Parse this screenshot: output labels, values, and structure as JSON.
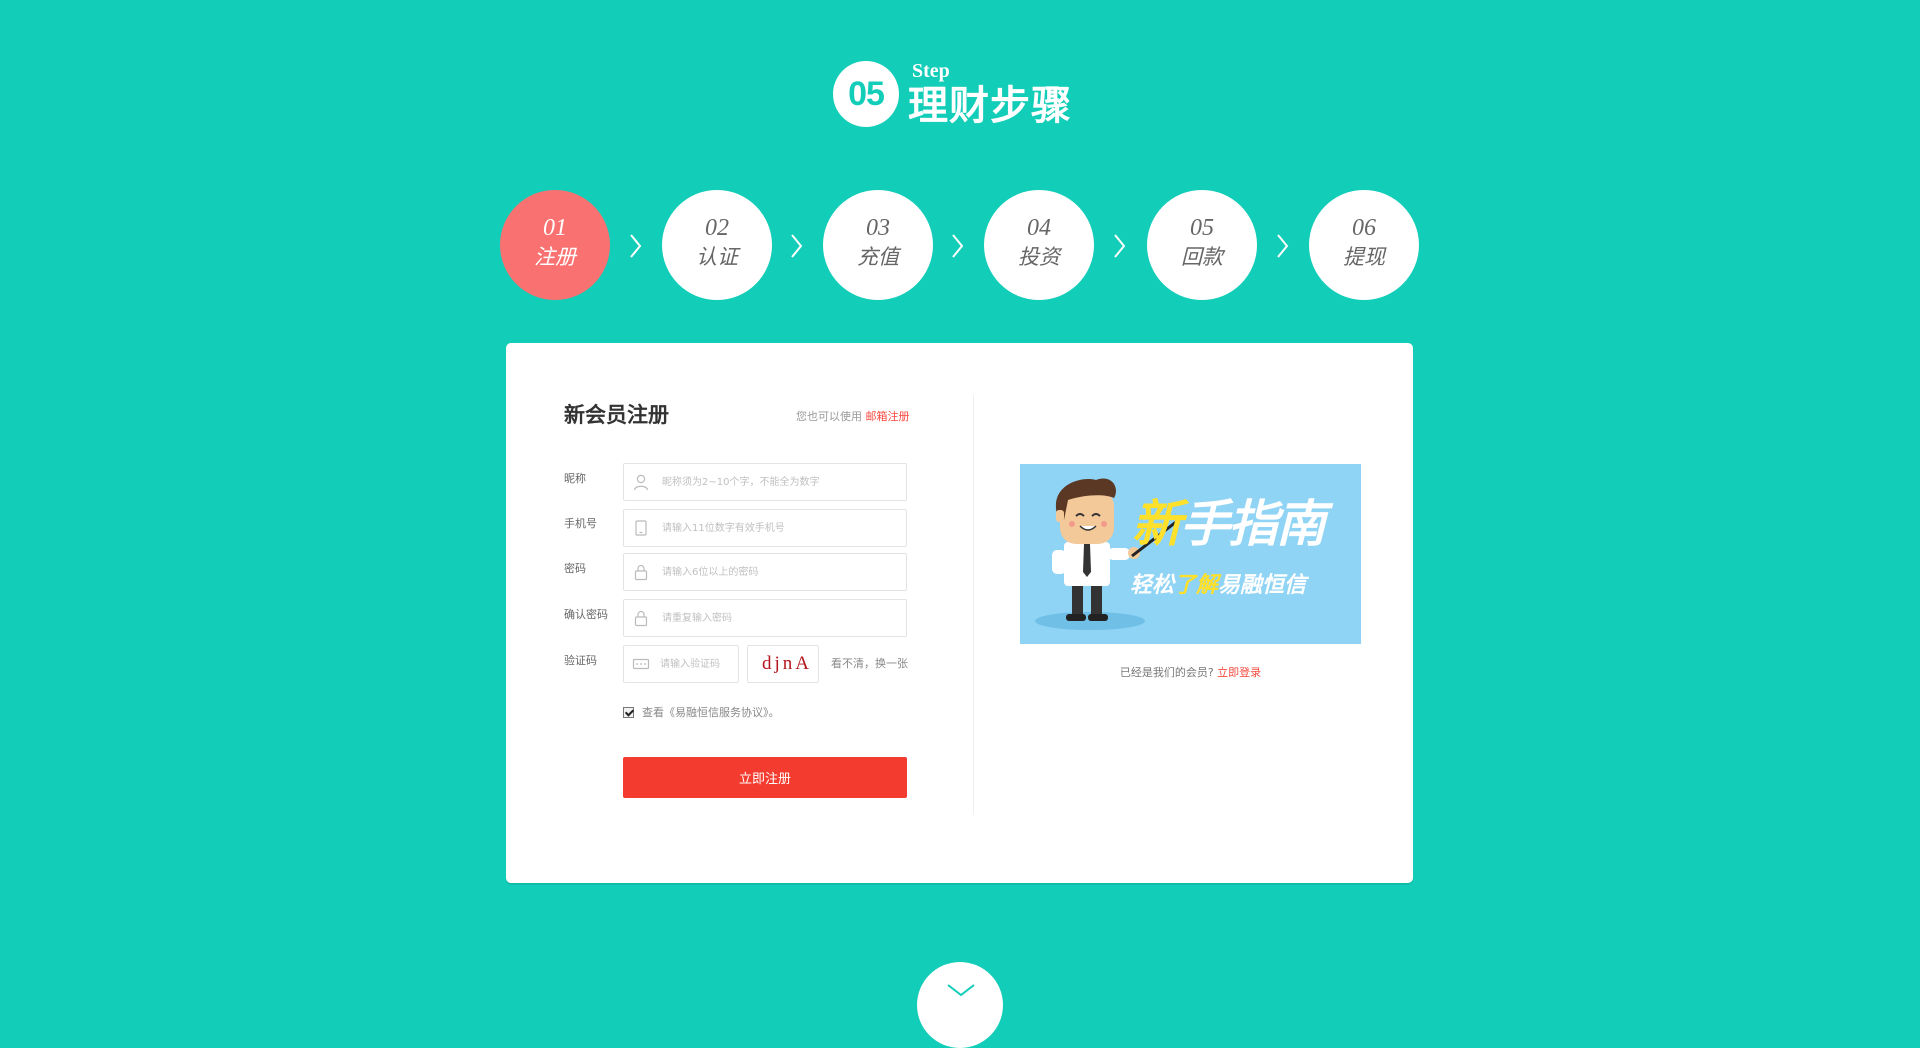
{
  "header": {
    "badge": "05",
    "step_word": "Step",
    "title": "理财步骤"
  },
  "steps": [
    {
      "num": "01",
      "label": "注册",
      "active": true
    },
    {
      "num": "02",
      "label": "认证",
      "active": false
    },
    {
      "num": "03",
      "label": "充值",
      "active": false
    },
    {
      "num": "04",
      "label": "投资",
      "active": false
    },
    {
      "num": "05",
      "label": "回款",
      "active": false
    },
    {
      "num": "06",
      "label": "提现",
      "active": false
    }
  ],
  "form": {
    "title": "新会员注册",
    "alt_text": "您也可以使用",
    "alt_link": "邮箱注册",
    "fields": {
      "nickname": {
        "label": "昵称",
        "placeholder": "昵称须为2~10个字，不能全为数字",
        "icon": "user-icon"
      },
      "phone": {
        "label": "手机号",
        "placeholder": "请输入11位数字有效手机号",
        "icon": "phone-icon"
      },
      "password": {
        "label": "密码",
        "placeholder": "请输入6位以上的密码",
        "icon": "lock-icon"
      },
      "confirm": {
        "label": "确认密码",
        "placeholder": "请重复输入密码",
        "icon": "lock-icon"
      },
      "captcha": {
        "label": "验证码",
        "placeholder": "请输入验证码",
        "icon": "captcha-icon"
      }
    },
    "captcha_text": "djnA",
    "refresh_text": "看不清，换一张",
    "agree_checked": true,
    "agree_text": "查看《易融恒信服务协议》。",
    "submit_label": "立即注册"
  },
  "banner": {
    "line1_highlight": "新",
    "line1_rest": "手指南",
    "line2_a": "轻松",
    "line2_highlight": "了解",
    "line2_b": "易融恒信"
  },
  "login_hint": {
    "text": "已经是我们的会员?",
    "link": "立即登录"
  },
  "colors": {
    "background": "#12cdb8",
    "active_step": "#f97171",
    "primary_button": "#f33c2f",
    "link": "#f54a3f"
  }
}
